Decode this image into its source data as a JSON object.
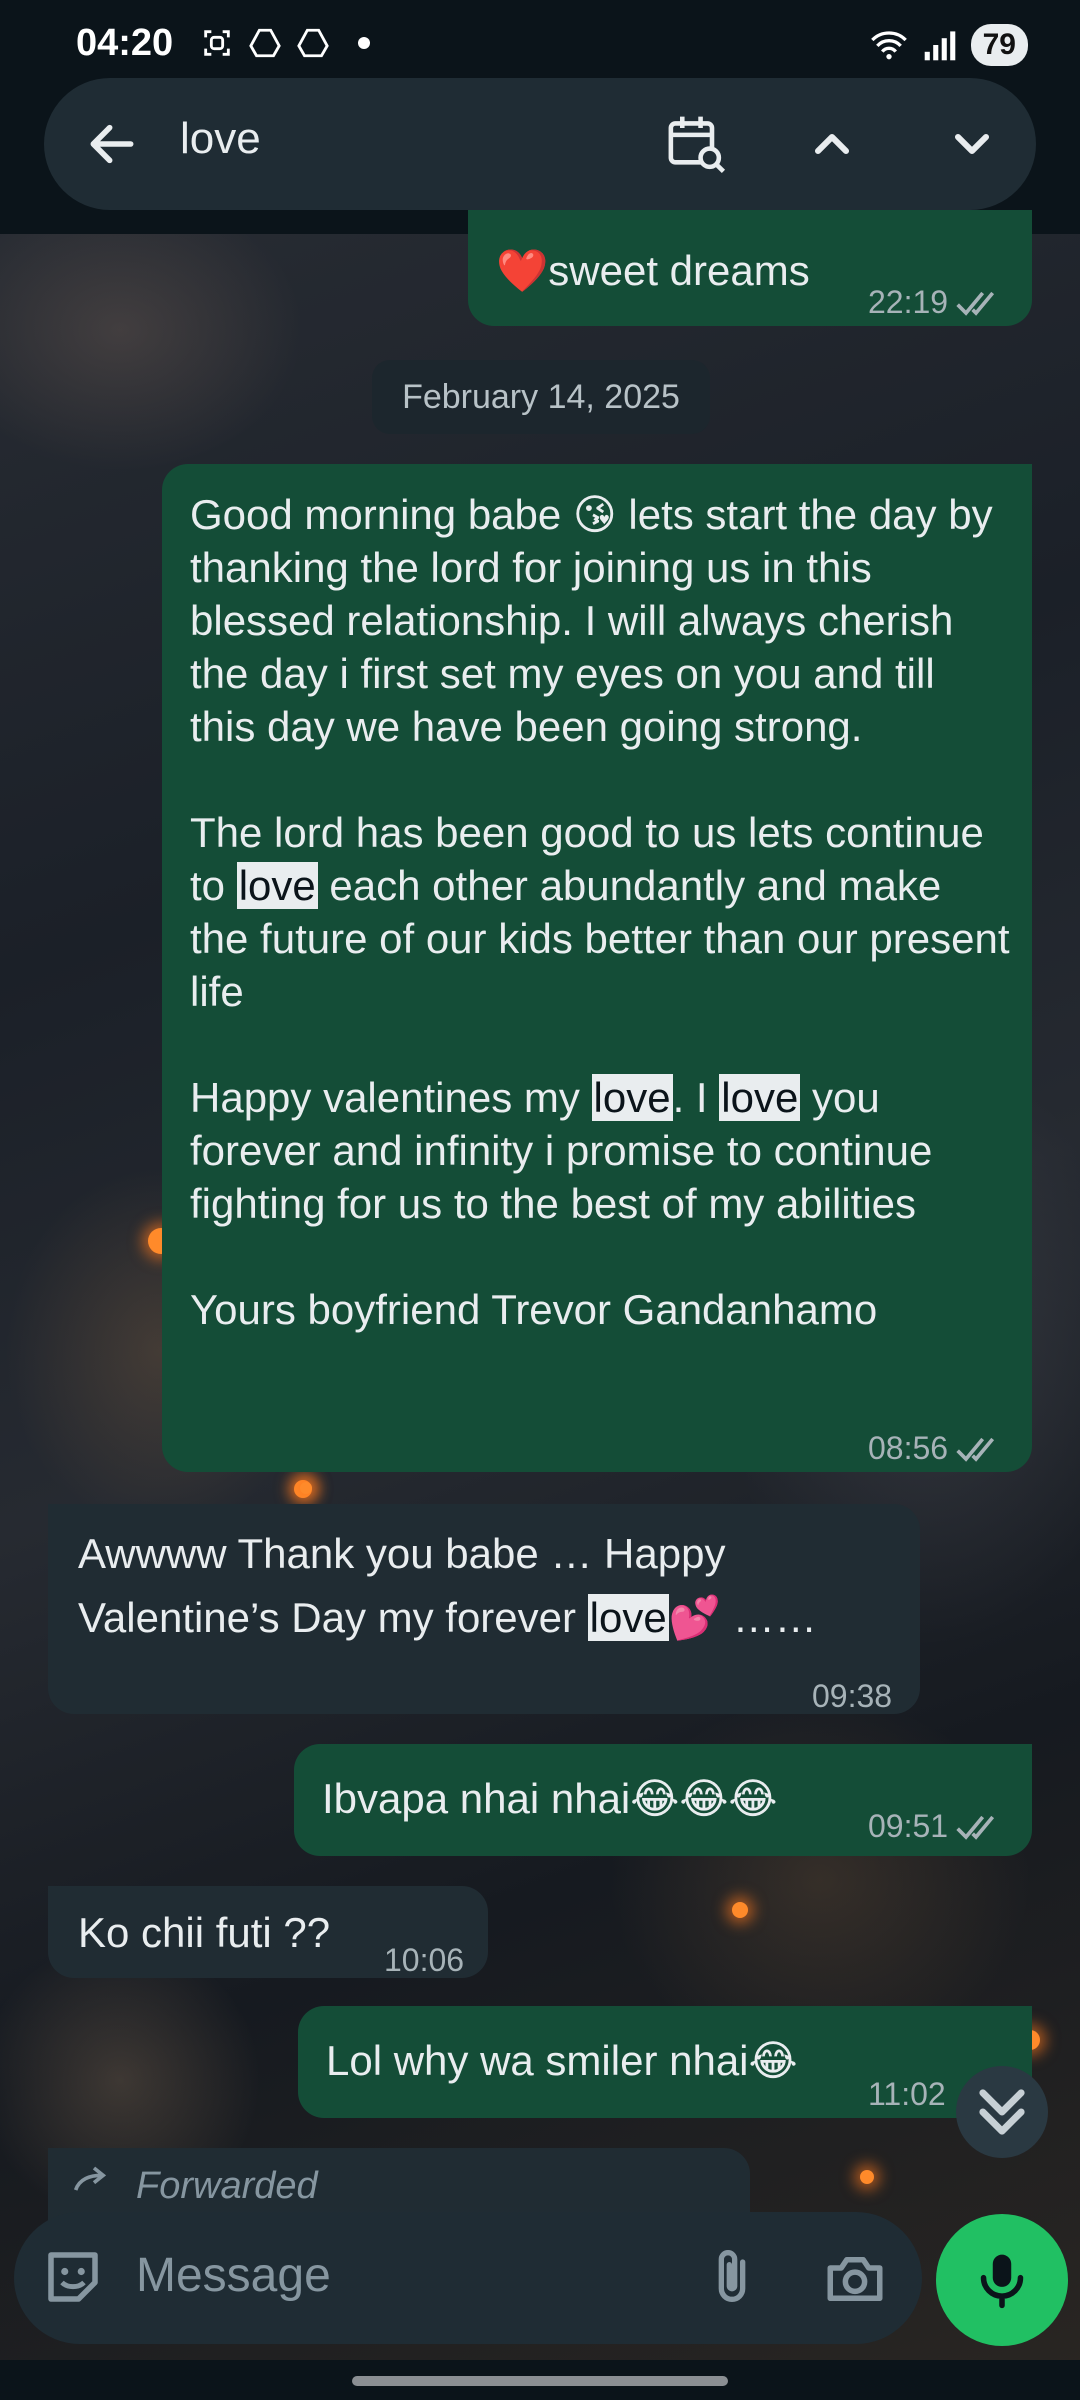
{
  "status_bar": {
    "time": "04:20",
    "battery": "79",
    "icons": [
      "screenshot-icon",
      "drive-icon",
      "drive-icon",
      "notification-dot",
      "wifi-icon",
      "signal-icon",
      "battery-icon"
    ]
  },
  "search": {
    "query": "love",
    "icons": [
      "back-arrow-icon",
      "calendar-search-icon",
      "chevron-up-icon",
      "chevron-down-icon"
    ]
  },
  "messages": {
    "m0": {
      "text": "sweet dreams",
      "emoji": "❤️",
      "time": "22:19"
    },
    "date_chip": "February 14, 2025",
    "m1": {
      "p1a": "Good morning babe ",
      "p1emoji": "😘",
      "p1b": "  lets start the day by thanking the lord for joining us in this blessed relationship. I will always cherish the day i first set my eyes on you and till this day we have been going strong.",
      "p2a": "The lord has been good to us lets continue to ",
      "p2hl": "love",
      "p2b": " each other abundantly and make the future of our kids better than our present life",
      "p3a": "Happy valentines my ",
      "p3hl1": "love",
      "p3b": ". I ",
      "p3hl2": "love",
      "p3c": " you forever and infinity i promise to continue fighting for us to the best of my abilities",
      "p4": "Yours boyfriend Trevor Gandanhamo",
      "time": "08:56"
    },
    "m2": {
      "a": "Awwww Thank you babe … Happy Valentine’s Day my forever ",
      "hl": "love",
      "emoji": "💕",
      "b": " ……",
      "time": "09:38"
    },
    "m3": {
      "text": "Ibvapa nhai nhai",
      "emoji": "😂😂😂",
      "time": "09:51"
    },
    "m4": {
      "text": "Ko chii futi ??",
      "time": "10:06"
    },
    "m5": {
      "text": "Lol why wa smiler nhai",
      "emoji": "😂",
      "time": "11:02"
    },
    "m6": {
      "label": "Forwarded"
    }
  },
  "composer": {
    "placeholder": "Message",
    "icons": [
      "sticker-icon",
      "attach-icon",
      "camera-icon",
      "mic-icon"
    ]
  },
  "colors": {
    "outgoing_bubble": "#144d37",
    "incoming_bubble": "#202c33",
    "accent_green": "#21c063",
    "highlight": "#e9edef"
  }
}
